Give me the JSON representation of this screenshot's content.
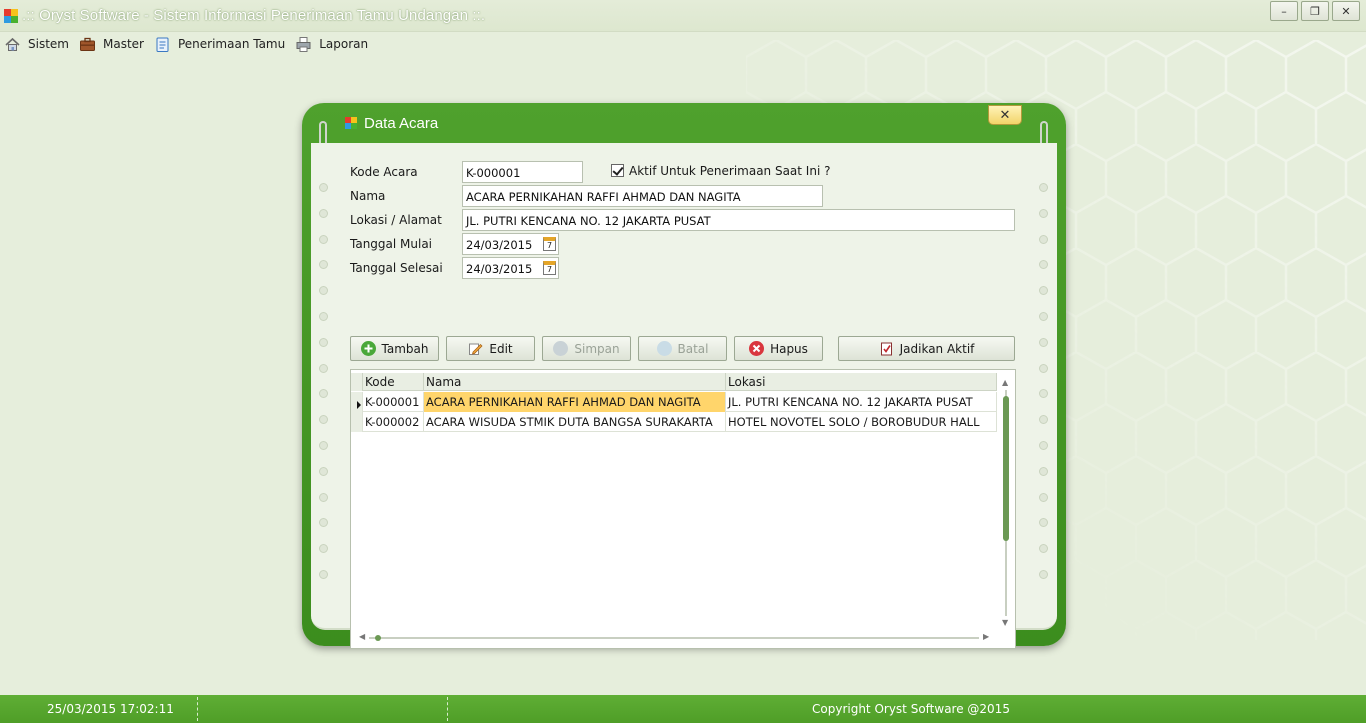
{
  "window": {
    "title": ".:: Oryst Software - Sistem Informasi Penerimaan Tamu Undangan ::.",
    "controls": {
      "minimize": "–",
      "restore": "❐",
      "close": "✕"
    }
  },
  "menu": {
    "items": [
      {
        "label": "Sistem",
        "icon": "home-icon"
      },
      {
        "label": "Master",
        "icon": "briefcase-icon"
      },
      {
        "label": "Penerimaan Tamu",
        "icon": "clipboard-icon"
      },
      {
        "label": "Laporan",
        "icon": "printer-icon"
      }
    ]
  },
  "dialog": {
    "title": "Data Acara",
    "close_label": "✕",
    "form": {
      "kode_acara_label": "Kode Acara",
      "kode_acara_value": "K-000001",
      "aktif_label": "Aktif Untuk Penerimaan Saat Ini ?",
      "aktif_checked": true,
      "nama_label": "Nama",
      "nama_value": "ACARA PERNIKAHAN RAFFI AHMAD DAN NAGITA",
      "lokasi_label": "Lokasi / Alamat",
      "lokasi_value": "JL. PUTRI KENCANA NO. 12 JAKARTA PUSAT",
      "tgl_mulai_label": "Tanggal Mulai",
      "tgl_mulai_value": "24/03/2015",
      "tgl_selesai_label": "Tanggal Selesai",
      "tgl_selesai_value": "24/03/2015",
      "calendar_glyph": "7"
    },
    "toolbar": {
      "tambah": "Tambah",
      "edit": "Edit",
      "simpan": "Simpan",
      "batal": "Batal",
      "hapus": "Hapus",
      "jadikan_aktif": "Jadikan Aktif"
    },
    "grid": {
      "columns": [
        "Kode",
        "Nama",
        "Lokasi"
      ],
      "rows": [
        {
          "kode": "K-000001",
          "nama": "ACARA PERNIKAHAN RAFFI AHMAD DAN NAGITA",
          "lokasi": "JL. PUTRI KENCANA NO. 12 JAKARTA PUSAT",
          "selected": true
        },
        {
          "kode": "K-000002",
          "nama": "ACARA WISUDA STMIK DUTA BANGSA SURAKARTA",
          "lokasi": "HOTEL NOVOTEL SOLO / BOROBUDUR HALL",
          "selected": false
        }
      ]
    }
  },
  "status": {
    "datetime": "25/03/2015 17:02:11",
    "copyright": "Copyright Oryst Software @2015"
  },
  "colors": {
    "accent_green": "#4fa12d",
    "selection": "#ffd56b",
    "background": "#e6eedc"
  }
}
